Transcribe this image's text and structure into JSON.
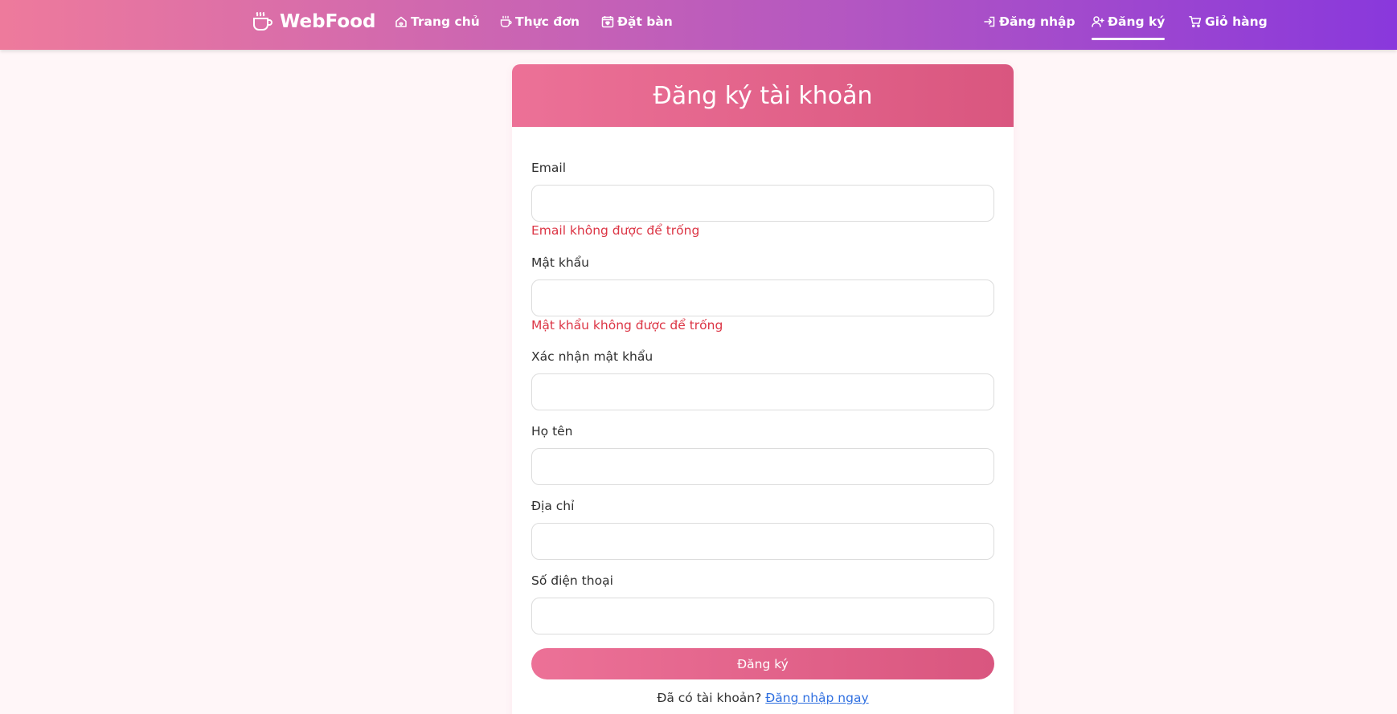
{
  "nav": {
    "brand": "WebFood",
    "links": [
      {
        "label": "Trang chủ",
        "icon": "home-icon"
      },
      {
        "label": "Thực đơn",
        "icon": "menu-cup-icon"
      },
      {
        "label": "Đặt bàn",
        "icon": "calendar-heart-icon"
      }
    ],
    "right_links": [
      {
        "label": "Đăng nhập",
        "icon": "login-icon"
      },
      {
        "label": "Đăng ký",
        "icon": "user-plus-icon",
        "active": true
      },
      {
        "label": "Giỏ hàng",
        "icon": "cart-icon"
      }
    ]
  },
  "form": {
    "title": "Đăng ký tài khoản",
    "fields": {
      "email": {
        "label": "Email",
        "value": "",
        "error": "Email không được để trống"
      },
      "password": {
        "label": "Mật khẩu",
        "value": "",
        "error": "Mật khẩu không được để trống"
      },
      "confirm": {
        "label": "Xác nhận mật khẩu",
        "value": ""
      },
      "name": {
        "label": "Họ tên",
        "value": ""
      },
      "address": {
        "label": "Địa chỉ",
        "value": ""
      },
      "phone": {
        "label": "Số điện thoại",
        "value": ""
      }
    },
    "submit_label": "Đăng ký",
    "footer_text": "Đã có tài khoản?",
    "footer_link": "Đăng nhập ngay"
  },
  "colors": {
    "nav_gradient_start": "#ee7a9c",
    "nav_gradient_end": "#8938dc",
    "accent_pink": "#e3648c",
    "error_red": "#dc3545",
    "link_blue": "#2f6fe0"
  }
}
